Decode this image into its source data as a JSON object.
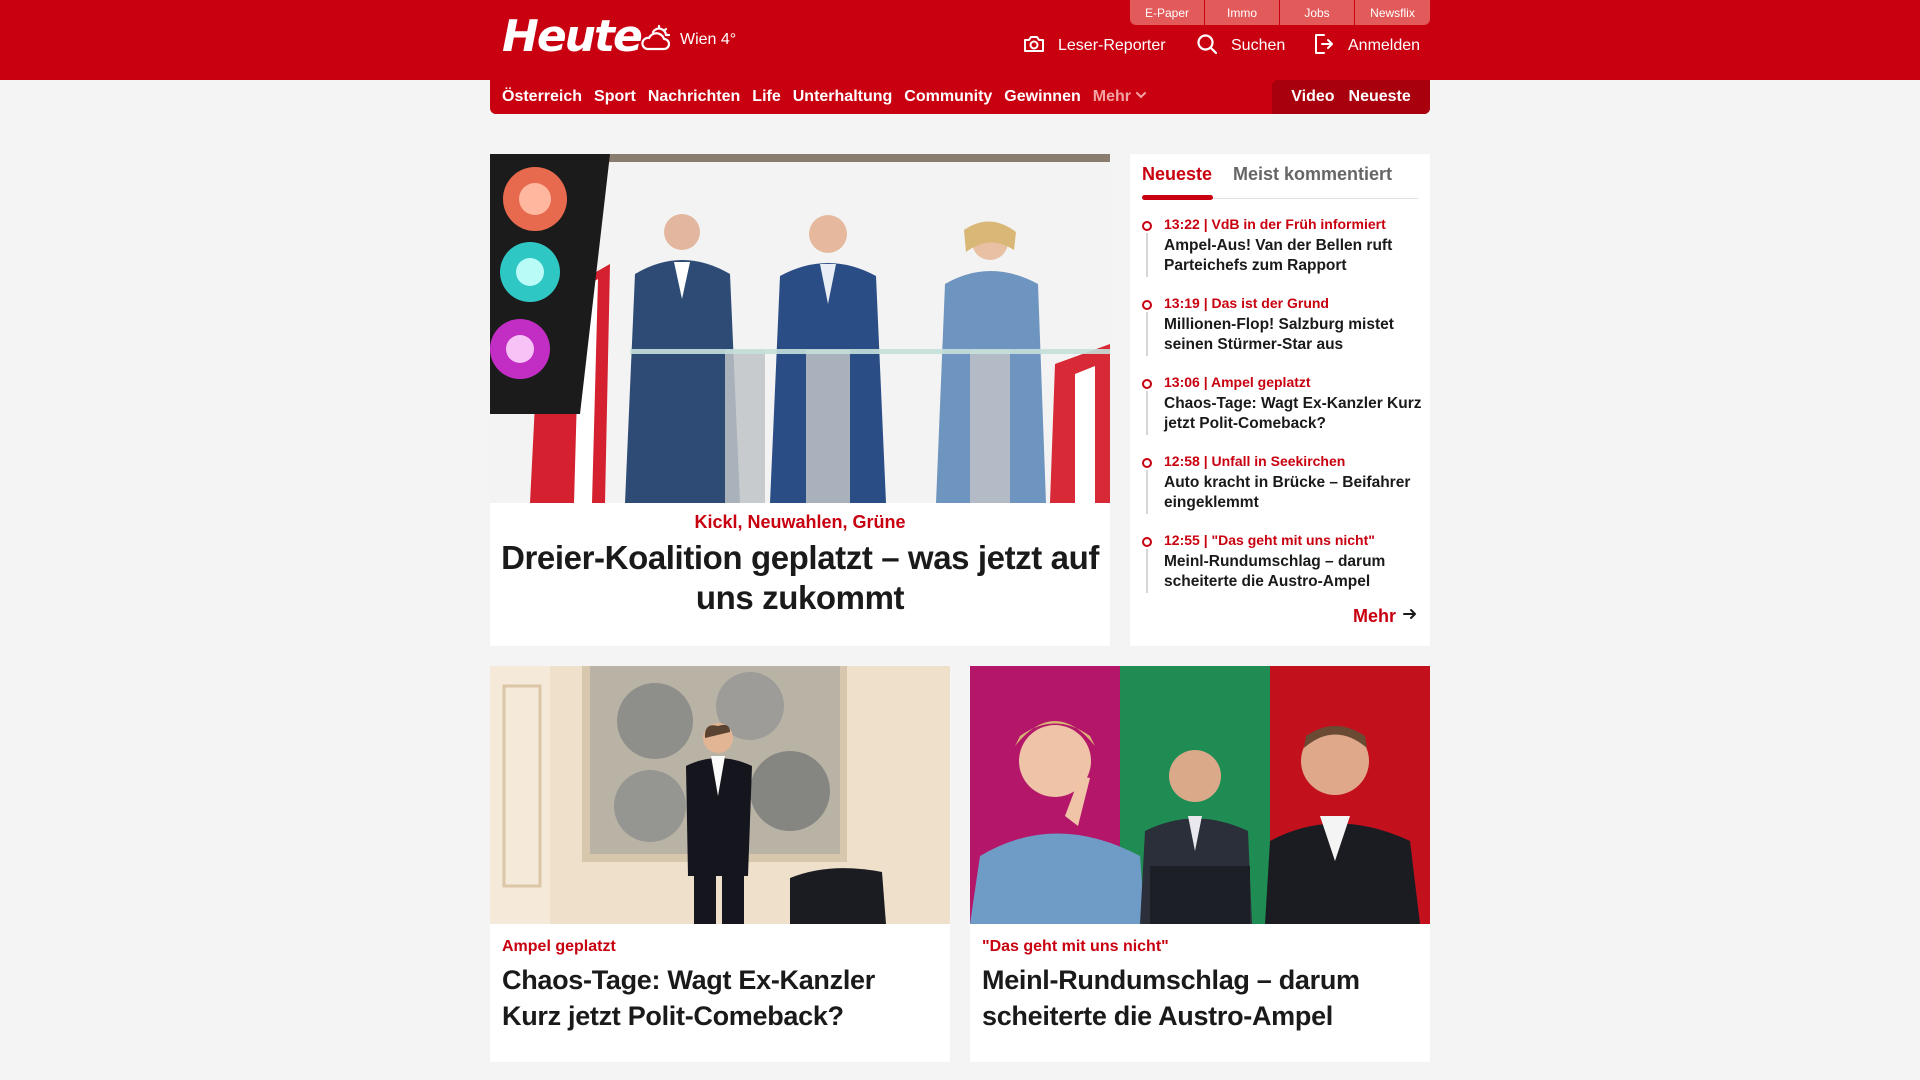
{
  "header": {
    "logo": "Heute",
    "weather": "Wien 4°",
    "service_tabs": [
      "E-Paper",
      "Immo",
      "Jobs",
      "Newsflix"
    ],
    "reporter_label": "Leser-Reporter",
    "search_label": "Suchen",
    "login_label": "Anmelden"
  },
  "nav": {
    "items": [
      "Österreich",
      "Sport",
      "Nachrichten",
      "Life",
      "Unterhaltung",
      "Community",
      "Gewinnen"
    ],
    "more_label": "Mehr",
    "video_label": "Video",
    "latest_label": "Neueste"
  },
  "hero": {
    "kicker": "Kickl, Neuwahlen, Grüne",
    "title": "Dreier-Koalition geplatzt – was jetzt auf uns zukommt"
  },
  "latest": {
    "tabs": [
      "Neueste",
      "Meist kommentiert"
    ],
    "items": [
      {
        "meta": "13:22 | VdB in der Früh informiert",
        "title": "Ampel-Aus! Van der Bellen ruft Parteichefs zum Rapport"
      },
      {
        "meta": "13:19 | Das ist der Grund",
        "title": "Millionen-Flop! Salzburg mistet seinen Stürmer-Star aus"
      },
      {
        "meta": "13:06 | Ampel geplatzt",
        "title": "Chaos-Tage: Wagt Ex-Kanzler Kurz jetzt Polit-Comeback?"
      },
      {
        "meta": "12:58 | Unfall in Seekirchen",
        "title": "Auto kracht in Brücke – Beifahrer eingeklemmt"
      },
      {
        "meta": "12:55 | \"Das geht mit uns nicht\"",
        "title": "Meinl-Rundumschlag – darum scheiterte die Austro-Ampel"
      }
    ],
    "more_label": "Mehr"
  },
  "cards": [
    {
      "kicker": "Ampel geplatzt",
      "title": "Chaos-Tage: Wagt Ex-Kanzler Kurz jetzt Polit-Comeback?"
    },
    {
      "kicker": "\"Das geht mit uns nicht\"",
      "title": "Meinl-Rundumschlag – darum scheiterte die Austro-Ampel"
    }
  ],
  "colors": {
    "brand_red": "#c8000f",
    "page_background": "#f4f4f4",
    "service_tab": "#e25a5a"
  },
  "icons": [
    "weather-cloud-sun-icon",
    "camera-icon",
    "search-icon",
    "login-icon",
    "chevron-down-icon",
    "arrow-right-icon"
  ]
}
